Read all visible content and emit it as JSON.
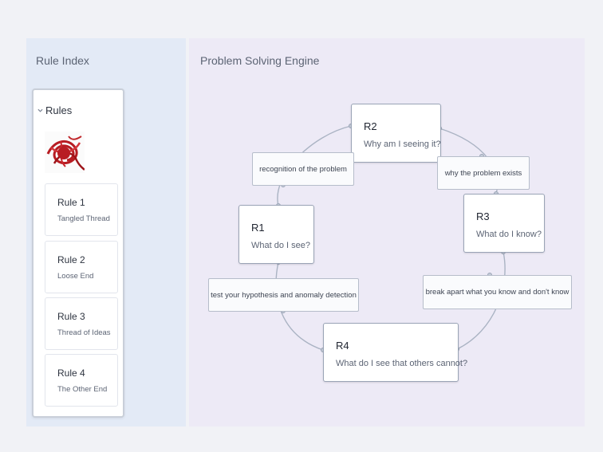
{
  "sidebar": {
    "title": "Rule Index",
    "panel_title": "Rules",
    "rules": [
      {
        "title": "Rule 1",
        "subtitle": "Tangled Thread"
      },
      {
        "title": "Rule 2",
        "subtitle": "Loose End"
      },
      {
        "title": "Rule 3",
        "subtitle": "Thread of Ideas"
      },
      {
        "title": "Rule 4",
        "subtitle": "The Other End"
      }
    ]
  },
  "main": {
    "title": "Problem Solving Engine",
    "nodes": {
      "r1": {
        "title": "R1",
        "subtitle": "What do I see?"
      },
      "r2": {
        "title": "R2",
        "subtitle": "Why am I seeing it?"
      },
      "r3": {
        "title": "R3",
        "subtitle": "What do I know?"
      },
      "r4": {
        "title": "R4",
        "subtitle": "What do I see that others cannot?"
      }
    },
    "edges": {
      "r1_r2": "recognition of the problem",
      "r2_r3": "why the problem exists",
      "r3_r4": "break apart what you know and don't know",
      "r4_r1": "test your hypothesis and anomaly detection"
    }
  },
  "colors": {
    "sidebar_bg": "#e3eaf6",
    "canvas_bg": "#edeaf6",
    "thread": "#c0262a"
  }
}
